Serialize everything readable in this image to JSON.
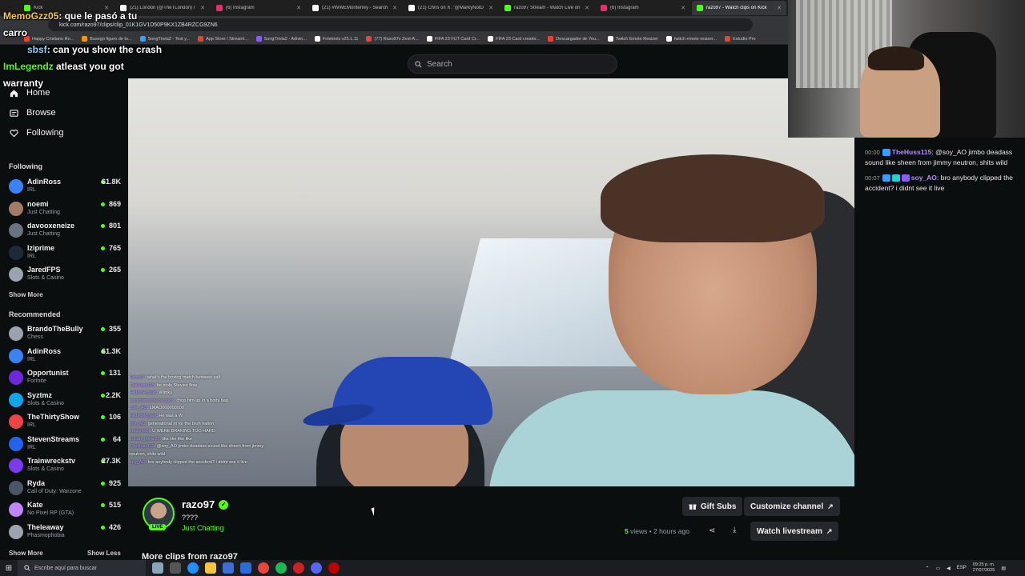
{
  "browser": {
    "tabs": [
      {
        "label": "Kick",
        "color": "#53fc18",
        "active": false
      },
      {
        "label": "(21) London (@TheTLondon) /",
        "color": "#ffffff",
        "active": false
      },
      {
        "label": "(6) Instagram",
        "color": "#e1306c",
        "active": false
      },
      {
        "label": "(21) #WWEMonterrey - Search",
        "color": "#ffffff",
        "active": false
      },
      {
        "label": "(21) Chris on X: \"@MarkyNotD",
        "color": "#ffffff",
        "active": false
      },
      {
        "label": "razo97 Stream - Watch Live on",
        "color": "#53fc18",
        "active": false
      },
      {
        "label": "(6) Instagram",
        "color": "#e1306c",
        "active": false
      },
      {
        "label": "razo97 - Watch clips on Kick",
        "color": "#53fc18",
        "active": true
      }
    ],
    "url": "kick.com/razo97/clips/clip_01K1GV1D50P9KX1ZB4RZCG9ZN6",
    "bookmarks": [
      {
        "label": "Happy Cristiano Ro...",
        "color": "#ff3b30"
      },
      {
        "label": "Busego figuro de to...",
        "color": "#ff9500"
      },
      {
        "label": "SongTrivia2 - Test y...",
        "color": "#3b9cff"
      },
      {
        "label": "App Store / Streaml...",
        "color": "#ff3b30"
      },
      {
        "label": "SongTrivia2 - Adivin...",
        "color": "#8a5cff"
      },
      {
        "label": "Foletools v25.1.11",
        "color": "#ffffff"
      },
      {
        "label": "(77) Razo97s Zest-A...",
        "color": "#ff3b30"
      },
      {
        "label": "FIFA 23 FUT Card Cr...",
        "color": "#ffffff"
      },
      {
        "label": "FIFA 23 Card creator...",
        "color": "#ffffff"
      },
      {
        "label": "Descargador de You...",
        "color": "#ff3b30"
      },
      {
        "label": "Twitch Emote Resizer",
        "color": "#ffffff"
      },
      {
        "label": "twitch emote resizer...",
        "color": "#ffffff"
      },
      {
        "label": "Estudio Pro",
        "color": "#ff3b30"
      }
    ]
  },
  "overlay_chat": {
    "lines": [
      {
        "user": "MemoGzz05",
        "text": ": que le pasó a tu"
      },
      {
        "user": "",
        "text": "carro"
      },
      {
        "user": "sbsf",
        "text": ": can you show the crash"
      },
      {
        "user": "ImLegendz",
        "text": " atleast you got"
      },
      {
        "user": "",
        "text": "warranty"
      }
    ]
  },
  "search": {
    "placeholder": "Search"
  },
  "nav": {
    "home": "Home",
    "browse": "Browse",
    "following": "Following"
  },
  "sidebar": {
    "following_title": "Following",
    "following": [
      {
        "name": "AdinRoss",
        "category": "IRL",
        "viewers": "61.8K",
        "color": "#3b82f6"
      },
      {
        "name": "noemi",
        "category": "Just Chatting",
        "viewers": "869",
        "color": "#a37b66"
      },
      {
        "name": "davooxeneize",
        "category": "Just Chatting",
        "viewers": "801",
        "color": "#6b7280"
      },
      {
        "name": "Iziprime",
        "category": "IRL",
        "viewers": "765",
        "color": "#1f2937"
      },
      {
        "name": "JaredFPS",
        "category": "Slots & Casino",
        "viewers": "265",
        "color": "#9ca3af"
      }
    ],
    "show_more_1": "Show More",
    "recommended_title": "Recommended",
    "recommended": [
      {
        "name": "BrandoTheBully",
        "category": "Chess",
        "viewers": "355",
        "color": "#9ca3af"
      },
      {
        "name": "AdinRoss",
        "category": "IRL",
        "viewers": "61.3K",
        "color": "#3b82f6"
      },
      {
        "name": "Opportunist",
        "category": "Fortnite",
        "viewers": "131",
        "color": "#6d28d9"
      },
      {
        "name": "Syztmz",
        "category": "Slots & Casino",
        "viewers": "2.2K",
        "color": "#0ea5e9"
      },
      {
        "name": "TheThirtyShow",
        "category": "IRL",
        "viewers": "106",
        "color": "#ef4444"
      },
      {
        "name": "StevenStreams",
        "category": "IRL",
        "viewers": "64",
        "color": "#2563eb"
      },
      {
        "name": "Trainwreckstv",
        "category": "Slots & Casino",
        "viewers": "27.3K",
        "color": "#7c3aed"
      },
      {
        "name": "Ryda",
        "category": "Call of Duty: Warzone",
        "viewers": "925",
        "color": "#4b5563"
      },
      {
        "name": "Kate",
        "category": "No Pixel RP (GTA)",
        "viewers": "515",
        "color": "#c084fc"
      },
      {
        "name": "Theleaway",
        "category": "Phasmophobia",
        "viewers": "426",
        "color": "#9ca3af"
      }
    ],
    "show_more_2": "Show More",
    "show_less": "Show Less"
  },
  "video_chat": [
    {
      "user": "Razo97",
      "text": ": what's the boxing match between yall"
    },
    {
      "user": "TheHuss115",
      "text": ": he stole Stevies flow"
    },
    {
      "user": "FadedPoptart",
      "text": ": Wimku"
    },
    {
      "user": "eastsidereplaybangers",
      "text": ": chop him up in a body bag"
    },
    {
      "user": "user_AO",
      "text": ": LMAO000000000"
    },
    {
      "user": "FadedPoptart",
      "text": ": He was a W"
    },
    {
      "user": "soy_AO",
      "text": ": generational rit for the bruh nation"
    },
    {
      "user": "crestyrock",
      "text": ": U WERE BRAKING TOO HARD"
    },
    {
      "user": "Lukan_jaime23",
      "text": ": like like like like"
    },
    {
      "user": "TheHuss115",
      "text": ": @soy_AO jimbo deadass sound like sheen from jimmy"
    },
    {
      "user": "",
      "text": "neutron, shits wild"
    },
    {
      "user": "soy_AO",
      "text": ": bro anybody clipped the accident? i didnt see it live"
    }
  ],
  "chat_panel": {
    "messages": [
      {
        "time": "00:00",
        "user": "TheHuss115",
        "text": ": @soy_AO jimbo deadass sound like sheen from jimmy neutron, shits wild"
      },
      {
        "time": "00:07",
        "user": "soy_AO",
        "text": ": bro anybody clipped the accident? i didnt see it live"
      }
    ]
  },
  "clip_info": {
    "live_badge": "LIVE",
    "channel_name": "razo97",
    "title": "????",
    "category": "Just Chatting",
    "gift_subs": "Gift Subs",
    "customize_channel": "Customize channel",
    "views_count": "5",
    "views_label": " views",
    "time_ago": " • 2 hours ago",
    "watch_livestream": "Watch livestream",
    "more_clips": "More clips from razo97"
  },
  "taskbar": {
    "search_placeholder": "Escribe aquí para buscar",
    "lang": "ESP",
    "time": "09:25 p. m.",
    "date": "27/07/2025"
  }
}
